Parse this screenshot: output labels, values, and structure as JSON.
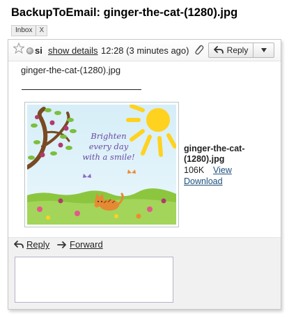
{
  "message": {
    "subject": "BackupToEmail: ginger-the-cat-(1280).jpg",
    "labels": [
      {
        "name": "Inbox",
        "remove": "X"
      }
    ],
    "sender": "si",
    "show_details": "show details",
    "time": "12:28 (3 minutes ago)",
    "reply_button": "Reply",
    "body": "ginger-the-cat-(1280).jpg"
  },
  "attachment": {
    "filename": "ginger-the-cat-(1280).jpg",
    "size": "106K",
    "view": "View",
    "download": "Download",
    "thumbnail_text": [
      "Brighten",
      "every day",
      "with a smile!"
    ]
  },
  "actions": {
    "reply": "Reply",
    "forward": "Forward",
    "reply_box_value": ""
  },
  "colors": {
    "link": "#1d4f7c",
    "sky": "#cfe9f5",
    "grass": "#8cc63f",
    "sun": "#ffd21f"
  },
  "icons": [
    "star-icon",
    "presence-icon",
    "paperclip-icon",
    "reply-arrow-icon",
    "dropdown-arrow-icon",
    "forward-arrow-icon"
  ]
}
